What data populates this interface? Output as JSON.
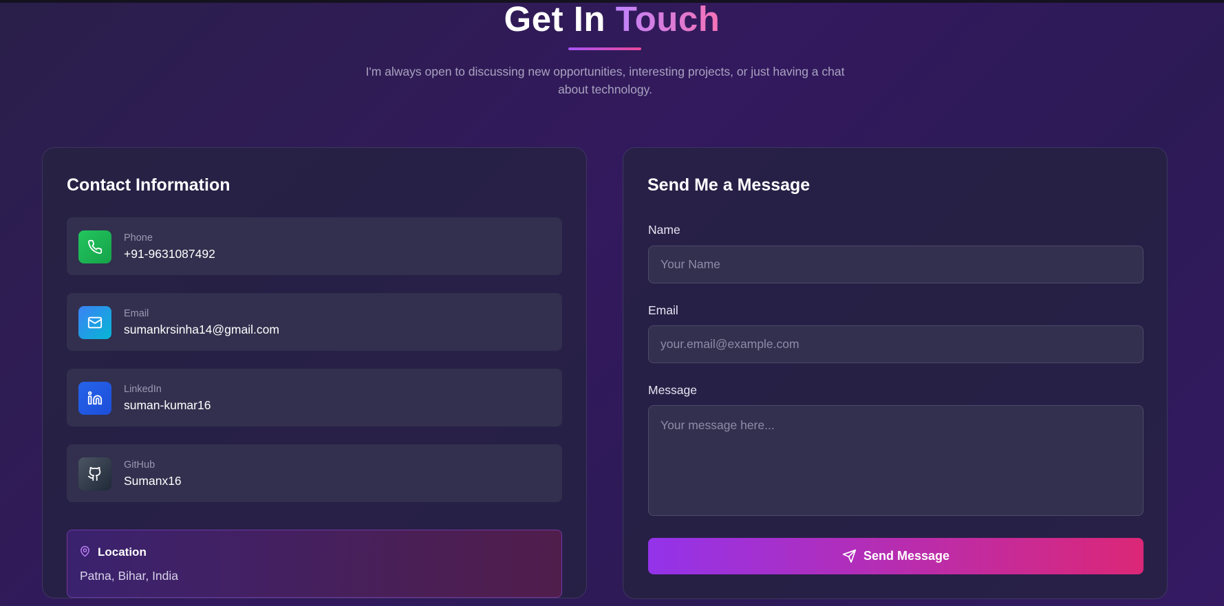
{
  "header": {
    "title_part1": "Get In",
    "title_part2": "Touch",
    "subtitle": "I'm always open to discussing new opportunities, interesting projects, or just having a chat about technology."
  },
  "contact": {
    "title": "Contact Information",
    "items": [
      {
        "label": "Phone",
        "value": "+91-9631087492",
        "icon": "phone-icon",
        "color": "#22c55e"
      },
      {
        "label": "Email",
        "value": "sumankrsinha14@gmail.com",
        "icon": "mail-icon",
        "color": "#3b82f6"
      },
      {
        "label": "LinkedIn",
        "value": "suman-kumar16",
        "icon": "linkedin-icon",
        "color": "#2563eb"
      },
      {
        "label": "GitHub",
        "value": "Sumanx16",
        "icon": "github-icon",
        "color": "#374151"
      }
    ],
    "location": {
      "title": "Location",
      "value": "Patna, Bihar, India"
    }
  },
  "form": {
    "title": "Send Me a Message",
    "name_label": "Name",
    "name_placeholder": "Your Name",
    "email_label": "Email",
    "email_placeholder": "your.email@example.com",
    "message_label": "Message",
    "message_placeholder": "Your message here...",
    "submit_label": "Send Message"
  },
  "colors": {
    "accent_start": "#a855f7",
    "accent_end": "#ec4899",
    "background": "#2e1a57"
  }
}
